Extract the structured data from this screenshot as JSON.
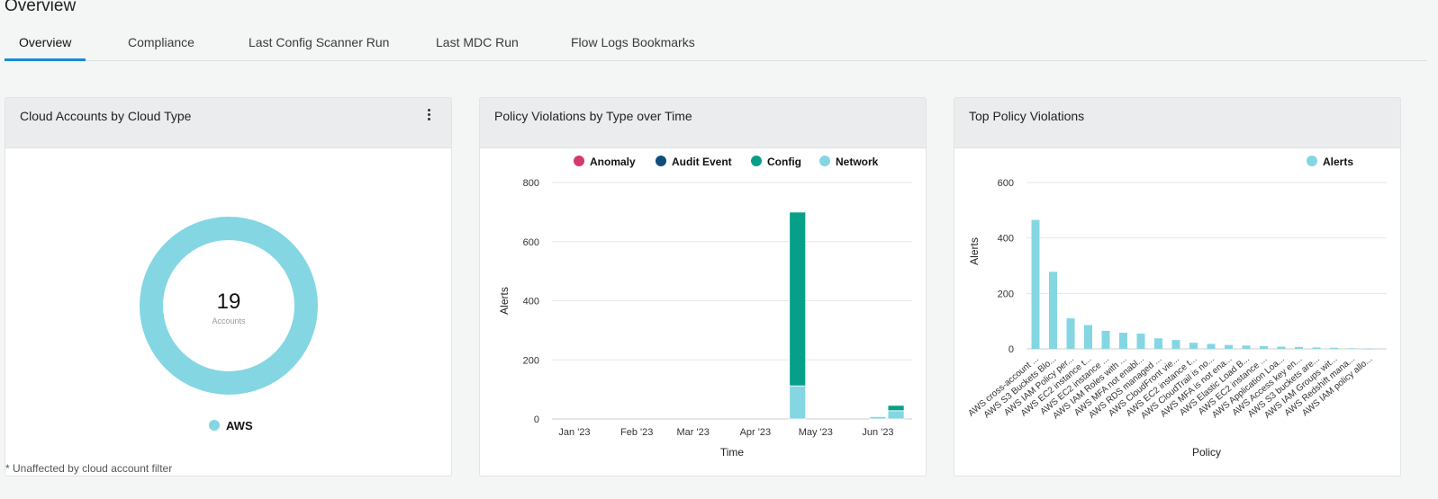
{
  "page": {
    "title": "Overview",
    "tabs": [
      {
        "label": "Overview",
        "active": true
      },
      {
        "label": "Compliance",
        "active": false
      },
      {
        "label": "Last Config Scanner Run",
        "active": false
      },
      {
        "label": "Last MDC Run",
        "active": false
      },
      {
        "label": "Flow Logs Bookmarks",
        "active": false
      }
    ]
  },
  "cards": {
    "accounts": {
      "title": "Cloud Accounts by Cloud Type",
      "footnote": "* Unaffected by cloud account filter"
    },
    "violations_time": {
      "title": "Policy Violations by Type over Time"
    },
    "top_violations": {
      "title": "Top Policy Violations"
    }
  },
  "chart_data": [
    {
      "type": "pie",
      "variant": "donut",
      "center_value": "19",
      "center_label": "Accounts",
      "categories": [
        "AWS"
      ],
      "values": [
        19
      ],
      "colors": [
        "#84d6e3"
      ],
      "legend_position": "bottom"
    },
    {
      "type": "bar",
      "stacked": true,
      "xlabel": "Time",
      "ylabel": "Alerts",
      "ylim": [
        0,
        800
      ],
      "yticks": [
        0,
        200,
        400,
        600,
        800
      ],
      "x_tick_labels": [
        "Jan '23",
        "Feb '23",
        "Mar '23",
        "Apr '23",
        "May '23",
        "Jun '23"
      ],
      "categories": [
        "2023-01-01",
        "2023-02-01",
        "2023-03-01",
        "2023-04-01",
        "2023-04-22",
        "2023-05-01",
        "2023-06-01",
        "2023-06-10"
      ],
      "series": [
        {
          "name": "Anomaly",
          "color": "#d63a6c",
          "values": [
            0,
            0,
            0,
            0,
            0,
            0,
            0,
            0
          ]
        },
        {
          "name": "Audit Event",
          "color": "#0f4e7a",
          "values": [
            0,
            0,
            0,
            0,
            0,
            0,
            0,
            0
          ]
        },
        {
          "name": "Network",
          "color": "#84d6e3",
          "values": [
            0,
            0,
            0,
            0,
            112,
            0,
            8,
            28
          ]
        },
        {
          "name": "Config",
          "color": "#06a088",
          "values": [
            0,
            0,
            0,
            0,
            588,
            0,
            0,
            18
          ]
        }
      ],
      "legend_position": "top",
      "grid": true
    },
    {
      "type": "bar",
      "xlabel": "Policy",
      "ylabel": "Alerts",
      "ylim": [
        0,
        600
      ],
      "yticks": [
        0,
        200,
        400,
        600
      ],
      "legend_position": "top-right",
      "series": [
        {
          "name": "Alerts",
          "color": "#84d6e3"
        }
      ],
      "categories": [
        "AWS cross-account ...",
        "AWS S3 Buckets Blo...",
        "AWS IAM Policy per...",
        "AWS EC2 instance t...",
        "AWS EC2 instance ...",
        "AWS IAM Roles with ...",
        "AWS MFA not enabl...",
        "AWS RDS managed ...",
        "AWS CloudFront vie...",
        "AWS EC2 instance t...",
        "AWS CloudTrail is no...",
        "AWS MFA is not ena...",
        "AWS Elastic Load B...",
        "AWS EC2 instance ...",
        "AWS Application Loa...",
        "AWS Access key en...",
        "AWS S3 buckets are...",
        "AWS IAM Groups wit...",
        "AWS Redshift mana...",
        "AWS IAM policy allo..."
      ],
      "values": [
        465,
        278,
        110,
        86,
        65,
        58,
        55,
        38,
        32,
        22,
        18,
        14,
        12,
        10,
        8,
        7,
        5,
        4,
        2,
        1
      ],
      "grid": true
    }
  ]
}
